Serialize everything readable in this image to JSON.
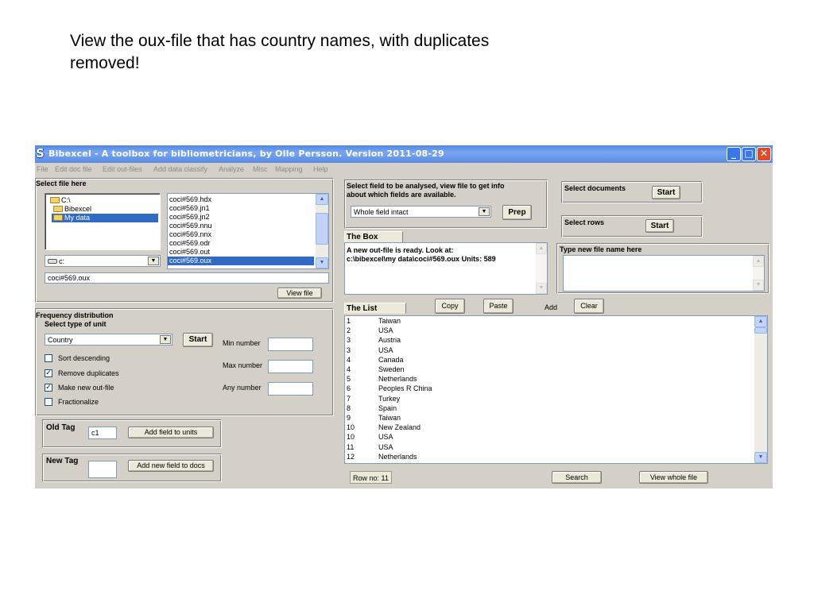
{
  "caption": "View the oux-file that has country names, with duplicates removed!",
  "window": {
    "title": "Bibexcel  -  A toolbox for bibliometricians, by Olle Persson. Version 2011-08-29"
  },
  "menu": [
    "File",
    "Edit doc file",
    "Edit out-files",
    "Add data classify",
    "Analyze",
    "Misc",
    "Mapping",
    "Help"
  ],
  "select_file": {
    "heading": "Select file here",
    "folders": [
      "C:\\",
      "Bibexcel",
      "My data"
    ],
    "files": [
      "coci#569.hdx",
      "coci#569.jn1",
      "coci#569.jn2",
      "coci#569.nnu",
      "coci#569.nnx",
      "coci#569.odr",
      "coci#569.out",
      "coci#569.oux"
    ],
    "drive": "c:",
    "file_name": "coci#569.oux",
    "view_file": "View file"
  },
  "field_select": {
    "heading_line1": "Select field to be analysed, view file to get info",
    "heading_line2": "about which fields are available.",
    "combo_value": "Whole field intact",
    "prep": "Prep"
  },
  "select_documents": {
    "label": "Select documents",
    "start": "Start"
  },
  "select_rows": {
    "label": "Select rows",
    "start": "Start"
  },
  "the_box": {
    "label": "The Box",
    "line1": "A new out-file is ready. Look at:",
    "line2": "c:\\bibexcel\\my data\\coci#569.oux Units: 589"
  },
  "new_file": {
    "label": "Type new file name here"
  },
  "frequency": {
    "heading": "Frequency distribution",
    "subheading": "Select type of unit",
    "unit_value": "Country",
    "start": "Start",
    "options": [
      {
        "label": "Sort descending",
        "checked": false
      },
      {
        "label": "Remove duplicates",
        "checked": true
      },
      {
        "label": "Make new out-file",
        "checked": true
      },
      {
        "label": "Fractionalize",
        "checked": false
      }
    ],
    "min_number": "Min number",
    "max_number": "Max number",
    "any_number": "Any number"
  },
  "old_tag": {
    "label": "Old Tag",
    "value": "c1",
    "button": "Add field to units"
  },
  "new_tag": {
    "label": "New Tag",
    "value": "",
    "button": "Add new field to docs"
  },
  "the_list": {
    "label": "The List",
    "copy": "Copy",
    "paste": "Paste",
    "add": "Add",
    "clear": "Clear",
    "rows": [
      {
        "n": "1",
        "country": "Taiwan"
      },
      {
        "n": "2",
        "country": "USA"
      },
      {
        "n": "3",
        "country": "Austria"
      },
      {
        "n": "3",
        "country": "USA"
      },
      {
        "n": "4",
        "country": "Canada"
      },
      {
        "n": "4",
        "country": "Sweden"
      },
      {
        "n": "5",
        "country": "Netherlands"
      },
      {
        "n": "6",
        "country": "Peoples R China"
      },
      {
        "n": "7",
        "country": "Turkey"
      },
      {
        "n": "8",
        "country": "Spain"
      },
      {
        "n": "9",
        "country": "Taiwan"
      },
      {
        "n": "10",
        "country": "New Zealand"
      },
      {
        "n": "10",
        "country": "USA"
      },
      {
        "n": "11",
        "country": "USA"
      },
      {
        "n": "12",
        "country": "Netherlands"
      }
    ]
  },
  "status": {
    "row_no": "Row no: 11",
    "search": "Search",
    "view_whole": "View whole file"
  },
  "icons": {
    "app": "bibexcel-logo-icon",
    "folder": "folder-icon",
    "drive": "drive-icon",
    "dropdown": "chevron-down-icon",
    "check": "checkmark-icon"
  },
  "colors": {
    "titlebar": "#4f86e6",
    "window_bg": "#d4d0c8",
    "selection": "#316ac5",
    "close_button": "#e04a2a"
  }
}
